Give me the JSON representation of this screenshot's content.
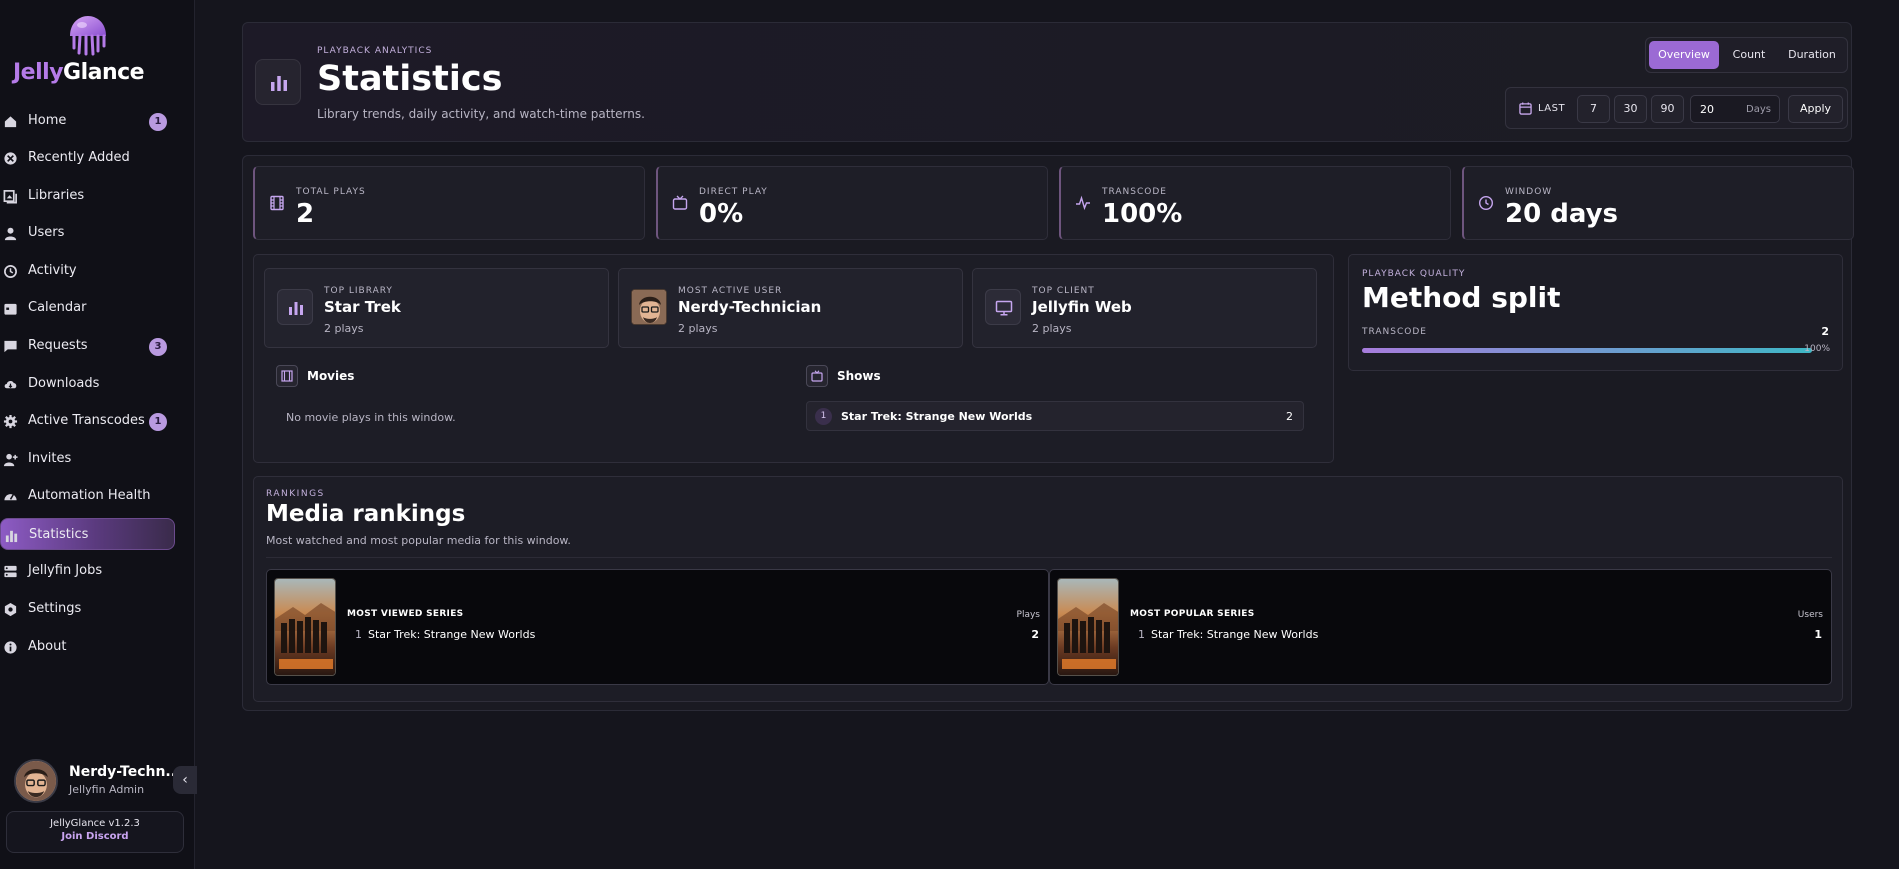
{
  "brand": {
    "name_part1": "Jelly",
    "name_part2": "Glance"
  },
  "sidebar": {
    "items": [
      {
        "label": "Home",
        "icon": "home-icon",
        "badge": "1"
      },
      {
        "label": "Recently Added",
        "icon": "sparkle-icon",
        "badge": ""
      },
      {
        "label": "Libraries",
        "icon": "library-icon",
        "badge": ""
      },
      {
        "label": "Users",
        "icon": "user-icon",
        "badge": ""
      },
      {
        "label": "Activity",
        "icon": "history-icon",
        "badge": ""
      },
      {
        "label": "Calendar",
        "icon": "calendar-icon",
        "badge": ""
      },
      {
        "label": "Requests",
        "icon": "message-icon",
        "badge": "3"
      },
      {
        "label": "Downloads",
        "icon": "cloud-download-icon",
        "badge": ""
      },
      {
        "label": "Active Transcodes",
        "icon": "gear-icon",
        "badge": "1"
      },
      {
        "label": "Invites",
        "icon": "user-plus-icon",
        "badge": ""
      },
      {
        "label": "Automation Health",
        "icon": "gauge-icon",
        "badge": ""
      },
      {
        "label": "Statistics",
        "icon": "bar-chart-icon",
        "badge": "",
        "active": true
      },
      {
        "label": "Jellyfin Jobs",
        "icon": "server-icon",
        "badge": ""
      },
      {
        "label": "Settings",
        "icon": "settings-icon",
        "badge": ""
      },
      {
        "label": "About",
        "icon": "info-icon",
        "badge": ""
      }
    ],
    "user": {
      "name": "Nerdy-Techn...",
      "role": "Jellyfin Admin"
    },
    "version": "JellyGlance v1.2.3",
    "discord": "Join Discord"
  },
  "header": {
    "eyebrow": "PLAYBACK ANALYTICS",
    "title": "Statistics",
    "subtitle": "Library trends, daily activity, and watch-time patterns.",
    "tabs": [
      "Overview",
      "Count",
      "Duration"
    ],
    "active_tab": "Overview",
    "range": {
      "label": "LAST",
      "presets": [
        "7",
        "30",
        "90"
      ],
      "value": "20",
      "unit": "Days",
      "apply": "Apply"
    }
  },
  "stats": [
    {
      "label": "TOTAL PLAYS",
      "value": "2",
      "icon": "film-icon"
    },
    {
      "label": "DIRECT PLAY",
      "value": "0%",
      "icon": "tv-icon"
    },
    {
      "label": "TRANSCODE",
      "value": "100%",
      "icon": "activity-icon"
    },
    {
      "label": "WINDOW",
      "value": "20 days",
      "icon": "clock-icon"
    }
  ],
  "highlights": [
    {
      "label": "TOP LIBRARY",
      "title": "Star Trek",
      "sub": "2 plays",
      "icon": "bar-chart-icon"
    },
    {
      "label": "MOST ACTIVE USER",
      "title": "Nerdy-Technician",
      "sub": "2 plays",
      "icon": "avatar"
    },
    {
      "label": "TOP CLIENT",
      "title": "Jellyfin Web",
      "sub": "2 plays",
      "icon": "monitor-icon"
    }
  ],
  "movies": {
    "heading": "Movies",
    "empty": "No movie plays in this window."
  },
  "shows": {
    "heading": "Shows",
    "rows": [
      {
        "rank": "1",
        "name": "Star Trek: Strange New Worlds",
        "count": "2"
      }
    ]
  },
  "quality": {
    "eyebrow": "PLAYBACK QUALITY",
    "title": "Method split",
    "bar_label": "TRANSCODE",
    "bar_count": "2",
    "bar_percent": "100%",
    "fraction": 1.0
  },
  "rankings": {
    "eyebrow": "RANKINGS",
    "title": "Media rankings",
    "subtitle": "Most watched and most popular media for this window.",
    "cards": [
      {
        "heading": "MOST VIEWED SERIES",
        "column": "Plays",
        "rank": "1",
        "name": "Star Trek: Strange New Worlds",
        "value": "2"
      },
      {
        "heading": "MOST POPULAR SERIES",
        "column": "Users",
        "rank": "1",
        "name": "Star Trek: Strange New Worlds",
        "value": "1"
      }
    ]
  },
  "colors": {
    "accent": "#9b6ad4",
    "badge": "#b99ae0",
    "progress_end": "#3fb7c6"
  }
}
